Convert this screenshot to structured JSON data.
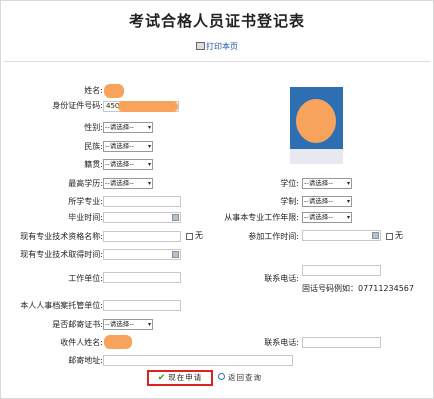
{
  "page": {
    "title": "考试合格人员证书登记表",
    "print_link": "打印本页"
  },
  "form": {
    "name_label": "姓名:",
    "id_label": "身份证件号码:",
    "id_value": "450",
    "gender_label": "性别:",
    "ethnicity_label": "民族:",
    "native_label": "籍贯:",
    "education_label": "最高学历:",
    "degree_label": "学位:",
    "major_label": "所学专业:",
    "schooling_label": "学制:",
    "grad_time_label": "毕业时间:",
    "years_label": "从事本专业工作年限:",
    "tech_title_label": "现有专业技术资格名称:",
    "none_label": "无",
    "work_start_label": "参加工作时间:",
    "tech_time_label": "现有专业技术取得时间:",
    "employer_label": "工作单位:",
    "phone_label": "联系电话:",
    "phone_hint": "固话号码例如：07711234567",
    "archive_label": "本人人事档案托管单位:",
    "mail_cert_label": "是否邮寄证书:",
    "recipient_label": "收件人姓名:",
    "phone2_label": "联系电话:",
    "address_label": "邮寄地址:",
    "select_placeholder": "--请选择--"
  },
  "actions": {
    "submit_label": "现在申请",
    "back_label": "返回查询"
  },
  "colors": {
    "accent_red": "#dd2222",
    "link_blue": "#2255aa",
    "photo_bg": "#2e6fb3",
    "redaction": "#f7a35c"
  },
  "icons": {
    "print": "printer-icon",
    "calendar": "calendar-icon",
    "submit": "check-icon",
    "back": "search-icon"
  }
}
